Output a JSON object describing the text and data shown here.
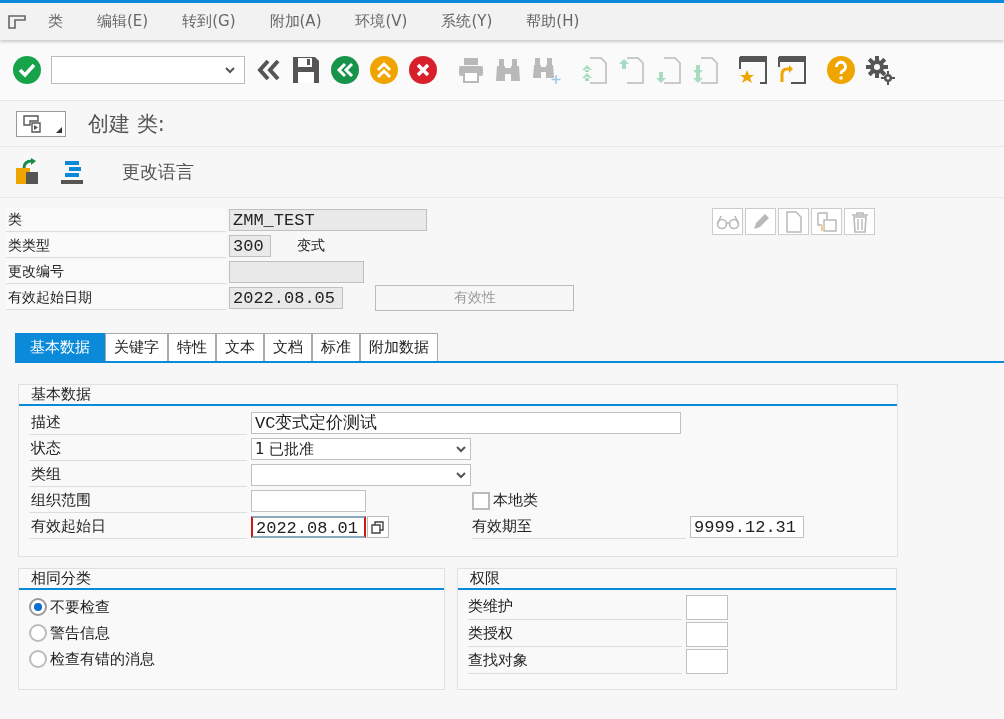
{
  "menu": [
    {
      "label": "类"
    },
    {
      "label": "编辑(E)"
    },
    {
      "label": "转到(G)"
    },
    {
      "label": "附加(A)"
    },
    {
      "label": "环境(V)"
    },
    {
      "label": "系统(Y)"
    },
    {
      "label": "帮助(H)"
    }
  ],
  "toolbar": [
    {
      "kind": "enter",
      "disabled": false
    },
    {
      "kind": "command",
      "disabled": false
    },
    {
      "kind": "collapse",
      "disabled": false
    },
    {
      "kind": "save",
      "disabled": false
    },
    {
      "kind": "back",
      "disabled": false
    },
    {
      "kind": "exit",
      "disabled": false
    },
    {
      "kind": "cancel",
      "disabled": false
    },
    {
      "kind": "print",
      "disabled": true
    },
    {
      "kind": "find",
      "disabled": true
    },
    {
      "kind": "find-next",
      "disabled": true
    },
    {
      "kind": "first-page",
      "disabled": true
    },
    {
      "kind": "prev-page",
      "disabled": true
    },
    {
      "kind": "next-page",
      "disabled": true
    },
    {
      "kind": "last-page",
      "disabled": true
    },
    {
      "kind": "new-session",
      "disabled": false
    },
    {
      "kind": "shortcut",
      "disabled": false
    },
    {
      "kind": "help",
      "disabled": false
    },
    {
      "kind": "settings",
      "disabled": false
    }
  ],
  "title": "创建 类:",
  "app_toolbar": {
    "buttons": [
      {
        "kind": "other-class"
      },
      {
        "kind": "hierarchy"
      }
    ],
    "change_language": "更改语言"
  },
  "header": {
    "class": {
      "label": "类",
      "value": "ZMM_TEST"
    },
    "class_type": {
      "label": "类类型",
      "value": "300",
      "text": "变式"
    },
    "change_number": {
      "label": "更改编号"
    },
    "valid_from": {
      "label": "有效起始日期",
      "value": "2022.08.05"
    },
    "validity_button": {
      "label": "有效性",
      "disabled": true
    },
    "actions": [
      {
        "kind": "display",
        "disabled": true
      },
      {
        "kind": "change",
        "disabled": true
      },
      {
        "kind": "create",
        "disabled": true
      },
      {
        "kind": "copy",
        "disabled": true
      },
      {
        "kind": "delete",
        "disabled": true
      }
    ]
  },
  "tabs": [
    {
      "label": "基本数据",
      "selected": true
    },
    {
      "label": "关键字",
      "selected": false
    },
    {
      "label": "特性",
      "selected": false
    },
    {
      "label": "文本",
      "selected": false
    },
    {
      "label": "文档",
      "selected": false
    },
    {
      "label": "标准",
      "selected": false
    },
    {
      "label": "附加数据",
      "selected": false
    }
  ],
  "basic_data": {
    "title": "基本数据",
    "description": {
      "label": "描述",
      "value": "VC变式定价测试"
    },
    "status": {
      "label": "状态",
      "value": "1 已批准"
    },
    "class_group": {
      "label": "类组"
    },
    "org_area": {
      "label": "组织范围"
    },
    "local_class": {
      "label": "本地类",
      "checked": false
    },
    "valid_from": {
      "label": "有效起始日",
      "value": "2022.08.01",
      "focused": true
    },
    "valid_to": {
      "label": "有效期至",
      "value": "9999.12.31"
    }
  },
  "same_classification": {
    "title": "相同分类",
    "options": [
      {
        "label": "不要检查",
        "selected": true
      },
      {
        "label": "警告信息",
        "selected": false
      },
      {
        "label": "检查有错的消息",
        "selected": false
      }
    ]
  },
  "authorizations": {
    "title": "权限",
    "fields": [
      {
        "label": "类维护"
      },
      {
        "label": "类授权"
      },
      {
        "label": "查找对象"
      }
    ]
  }
}
